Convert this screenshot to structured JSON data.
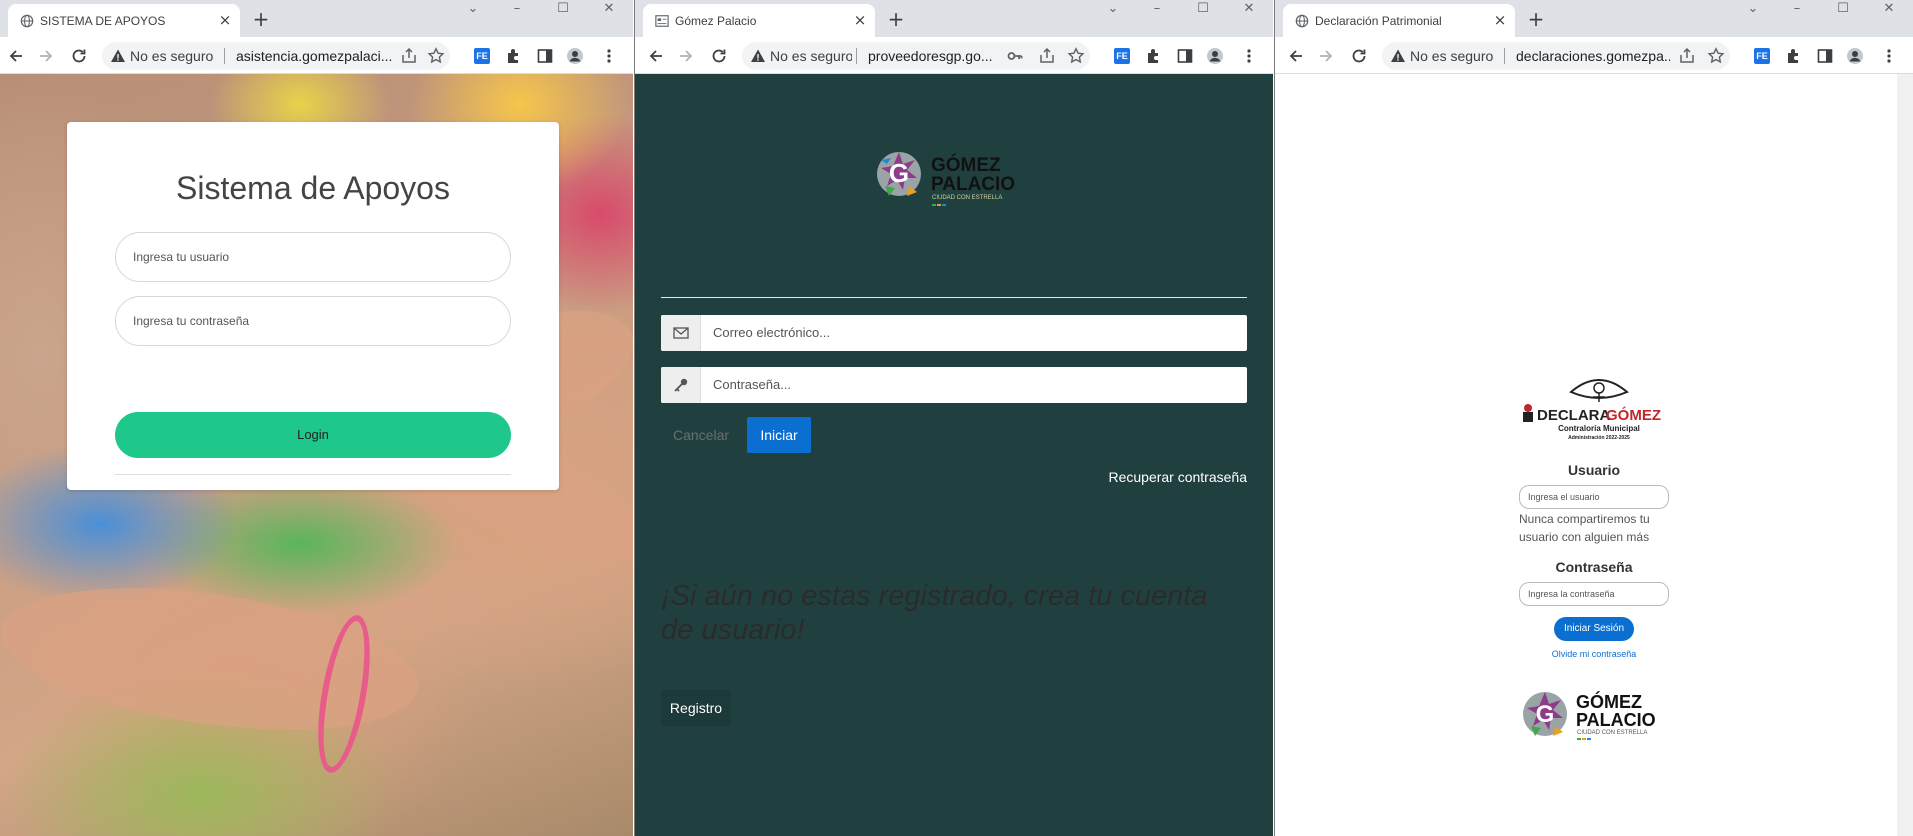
{
  "windows": [
    {
      "tab_title": "SISTEMA DE APOYOS",
      "security_text": "No es seguro",
      "url": "asistencia.gomezpalaci...",
      "page": {
        "title": "Sistema de Apoyos",
        "username_placeholder": "Ingresa tu usuario",
        "password_placeholder": "Ingresa tu contraseña",
        "login_label": "Login"
      }
    },
    {
      "tab_title": "Gómez Palacio",
      "security_text": "No es seguro",
      "url": "proveedoresgp.go...",
      "page": {
        "logo_line1": "GÓMEZ",
        "logo_line2": "PALACIO",
        "logo_tagline": "CIUDAD CON ESTRELLA",
        "email_placeholder": "Correo electrónico...",
        "password_placeholder": "Contraseña...",
        "cancel_label": "Cancelar",
        "start_label": "Iniciar",
        "recover_label": "Recuperar contraseña",
        "cta_text": "¡Si aún no estas registrado, crea tu cuenta de usuario!",
        "register_label": "Registro"
      }
    },
    {
      "tab_title": "Declaración Patrimonial",
      "security_text": "No es seguro",
      "url": "declaraciones.gomezpa...",
      "page": {
        "logo_declara": "DECLARA",
        "logo_gomez": "GÓMEZ",
        "logo_sub1": "Contraloría Municipal",
        "logo_sub2": "Administración 2022-2025",
        "user_label": "Usuario",
        "user_placeholder": "Ingresa el usuario",
        "user_help": "Nunca compartiremos tu usuario con alguien más",
        "password_label": "Contraseña",
        "password_placeholder": "Ingresa la contraseña",
        "login_label": "Iniciar Sesión",
        "forgot_label": "Olvide mi contraseña",
        "footer_logo_line1": "GÓMEZ",
        "footer_logo_line2": "PALACIO",
        "footer_logo_tagline": "CIUDAD CON ESTRELLA"
      }
    }
  ],
  "colors": {
    "login_green": "#1ec88b",
    "primary_blue": "#0b6fd1",
    "dark_teal": "#1f403f",
    "declara_red": "#c0272d"
  },
  "icons": [
    "globe-icon",
    "close-icon",
    "plus-icon",
    "back-icon",
    "forward-icon",
    "reload-icon",
    "warning-icon",
    "share-icon",
    "star-icon",
    "extension-icon",
    "sidebar-icon",
    "profile-icon",
    "menu-icon",
    "key-icon",
    "envelope-icon"
  ]
}
